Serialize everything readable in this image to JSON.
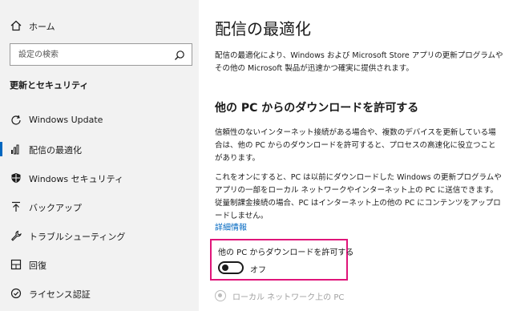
{
  "sidebar": {
    "home_label": "ホーム",
    "search_placeholder": "設定の検索",
    "section_title": "更新とセキュリティ",
    "items": [
      {
        "label": "Windows Update",
        "icon": "sync-icon"
      },
      {
        "label": "配信の最適化",
        "icon": "delivery-optimization-icon"
      },
      {
        "label": "Windows セキュリティ",
        "icon": "shield-icon"
      },
      {
        "label": "バックアップ",
        "icon": "backup-icon"
      },
      {
        "label": "トラブルシューティング",
        "icon": "wrench-icon"
      },
      {
        "label": "回復",
        "icon": "recovery-icon"
      },
      {
        "label": "ライセンス認証",
        "icon": "activation-icon"
      }
    ],
    "active_index": 1
  },
  "main": {
    "title": "配信の最適化",
    "intro": "配信の最適化により、Windows および Microsoft Store アプリの更新プログラムやその他の Microsoft 製品が迅速かつ確実に提供されます。",
    "subheading": "他の PC からのダウンロードを許可する",
    "para1": "信頼性のないインターネット接続がある場合や、複数のデバイスを更新している場合は、他の PC からのダウンロードを許可すると、プロセスの高速化に役立つことがあります。",
    "para2": "これをオンにすると、PC は以前にダウンロードした Windows の更新プログラムやアプリの一部をローカル ネットワークやインターネット上の PC に送信できます。従量制課金接続の場合、PC はインターネット上の他の PC にコンテンツをアップロードしません。",
    "details_link": "詳細情報",
    "toggle": {
      "label": "他の PC からダウンロードを許可する",
      "state": "オフ",
      "on": false
    },
    "radio_label": "ローカル ネットワーク上の PC"
  },
  "colors": {
    "accent": "#0067c0",
    "highlight_border": "#e0157a",
    "sidebar_bg": "#f2f2f2"
  }
}
